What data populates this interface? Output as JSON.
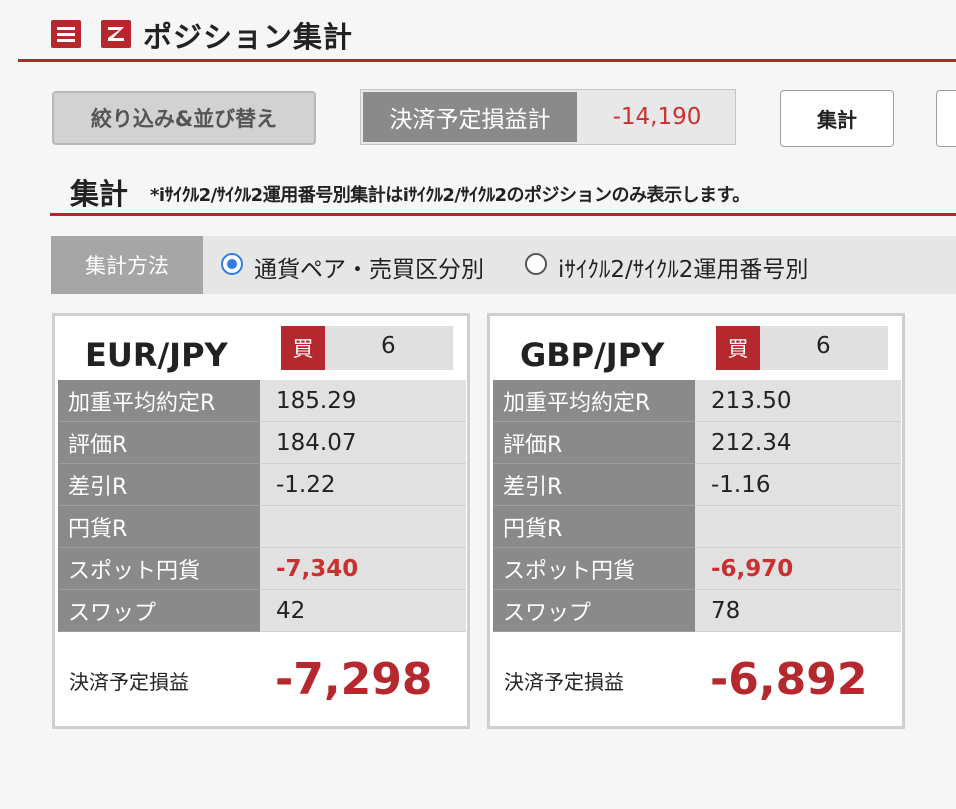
{
  "header": {
    "title": "ポジション集計",
    "menu_icon": "menu-icon",
    "logo_icon": "z-logo-icon",
    "accent_color": "#b5282e"
  },
  "toolbar": {
    "filter_sort_label": "絞り込み&並び替え",
    "settlement_pl_label": "決済予定損益計",
    "settlement_pl_value": "-14,190",
    "aggregate_label": "集計"
  },
  "section": {
    "title": "集計",
    "note": "*iｻｲｸﾙ2/ｻｲｸﾙ2運用番号別集計はiｻｲｸﾙ2/ｻｲｸﾙ2のポジションのみ表示します。"
  },
  "method": {
    "label": "集計方法",
    "option1": "通貨ペア・売買区分別",
    "option2": "iｻｲｸﾙ2/ｻｲｸﾙ2運用番号別",
    "selected": "通貨ペア・売買区分別"
  },
  "cards": [
    {
      "pair": "EUR/JPY",
      "side": "買",
      "count": "6",
      "rows": [
        {
          "label": "加重平均約定R",
          "value": "185.29"
        },
        {
          "label": "評価R",
          "value": "184.07"
        },
        {
          "label": "差引R",
          "value": "-1.22"
        },
        {
          "label": "円貨R",
          "value": ""
        },
        {
          "label": "スポット円貨",
          "value": "-7,340"
        },
        {
          "label": "スワップ",
          "value": "42"
        }
      ],
      "pl_label": "決済予定損益",
      "pl_value": "-7,298"
    },
    {
      "pair": "GBP/JPY",
      "side": "買",
      "count": "6",
      "rows": [
        {
          "label": "加重平均約定R",
          "value": "213.50"
        },
        {
          "label": "評価R",
          "value": "212.34"
        },
        {
          "label": "差引R",
          "value": "-1.16"
        },
        {
          "label": "円貨R",
          "value": ""
        },
        {
          "label": "スポット円貨",
          "value": "-6,970"
        },
        {
          "label": "スワップ",
          "value": "78"
        }
      ],
      "pl_label": "決済予定損益",
      "pl_value": "-6,892"
    }
  ]
}
